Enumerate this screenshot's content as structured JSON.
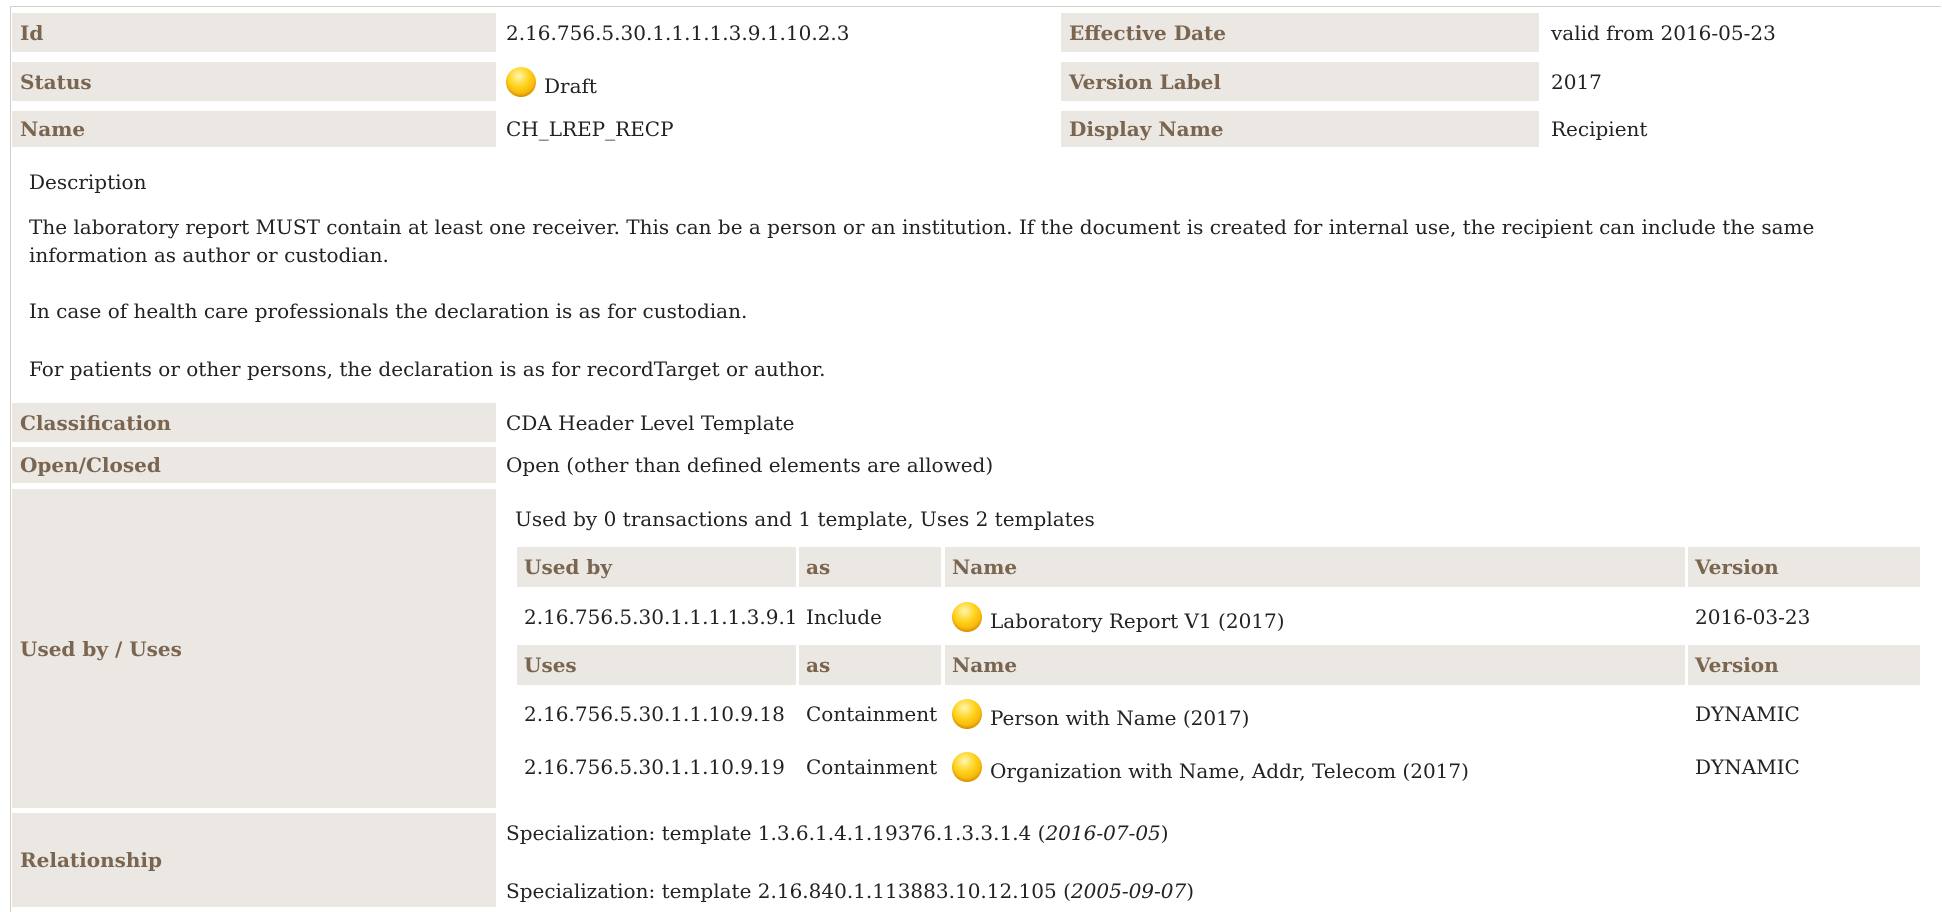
{
  "header_rows": [
    {
      "label": "Id",
      "value": "2.16.756.5.30.1.1.1.1.3.9.1.10.2.3",
      "label2": "Effective Date",
      "value2": "valid from 2016-05-23"
    },
    {
      "label": "Status",
      "value": "Draft",
      "label2": "Version Label",
      "value2": "2017"
    },
    {
      "label": "Name",
      "value": "CH_LREP_RECP",
      "label2": "Display Name",
      "value2": "Recipient"
    }
  ],
  "description": {
    "heading": "Description",
    "paragraphs": [
      "The laboratory report MUST contain at least one receiver. This can be a person or an institution. If the document is created for internal use, the recipient can include the same information as author or custodian.",
      "In case of health care professionals the declaration is as for custodian.",
      "For patients or other persons, the declaration is as for recordTarget or author."
    ]
  },
  "classification": {
    "label": "Classification",
    "value": "CDA Header Level Template"
  },
  "open_closed": {
    "label": "Open/Closed",
    "value": "Open (other than defined elements are allowed)"
  },
  "used_by_uses": {
    "label": "Used by / Uses",
    "summary": "Used by 0 transactions and 1 template, Uses 2 templates",
    "used_by_header": {
      "col1": "Used by",
      "col2": "as",
      "col3": "Name",
      "col4": "Version"
    },
    "used_by_rows": [
      {
        "id": "2.16.756.5.30.1.1.1.1.3.9.1",
        "as": "Include",
        "name": "Laboratory Report V1 (2017)",
        "version": "2016-03-23"
      }
    ],
    "uses_header": {
      "col1": "Uses",
      "col2": "as",
      "col3": "Name",
      "col4": "Version"
    },
    "uses_rows": [
      {
        "id": "2.16.756.5.30.1.1.10.9.18",
        "as": "Containment",
        "name": "Person with Name (2017)",
        "version": "DYNAMIC"
      },
      {
        "id": "2.16.756.5.30.1.1.10.9.19",
        "as": "Containment",
        "name": "Organization with Name, Addr, Telecom (2017)",
        "version": "DYNAMIC"
      }
    ]
  },
  "relationship": {
    "label": "Relationship",
    "items": [
      {
        "text": "Specialization: template 1.3.6.1.4.1.19376.1.3.3.1.4 (",
        "date": "2016-07-05",
        "close": ")"
      },
      {
        "text": "Specialization: template 2.16.840.1.113883.10.12.105 (",
        "date": "2005-09-07",
        "close": ")"
      }
    ]
  },
  "colors": {
    "label_bg": "#ebe7e2",
    "label_text": "#7a6650",
    "status_dot": "#ffc800"
  },
  "icons": {
    "status": "status-draft-icon"
  }
}
